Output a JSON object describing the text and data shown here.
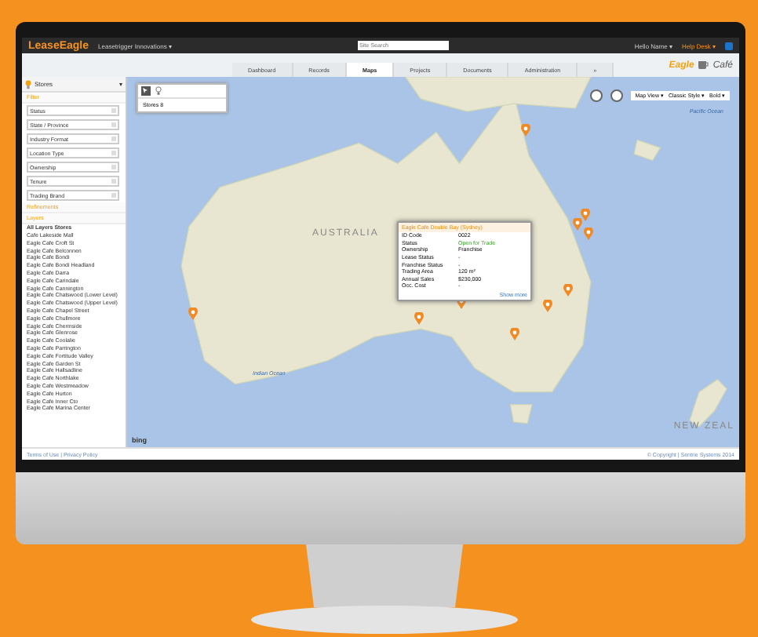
{
  "topbar": {
    "logo": "LeaseEagle",
    "org": "Leasetrigger Innovations ▾",
    "search_placeholder": "Site Search",
    "user": "Hello Name ▾",
    "help": "Help Desk ▾"
  },
  "tabs": [
    {
      "label": "Dashboard",
      "selected": false
    },
    {
      "label": "Records",
      "selected": false
    },
    {
      "label": "Maps",
      "selected": true
    },
    {
      "label": "Projects",
      "selected": false
    },
    {
      "label": "Documents",
      "selected": false
    },
    {
      "label": "Administration",
      "selected": false
    },
    {
      "label": "»",
      "selected": false
    }
  ],
  "brand": {
    "name": "Eagle",
    "sub": "Café"
  },
  "sidebar": {
    "title": "Stores",
    "caret": "▾",
    "filter_heading": "Filter",
    "filters": [
      "Status",
      "State / Province",
      "Industry Format",
      "Location Type",
      "Ownership",
      "Tenure",
      "Trading Brand"
    ],
    "refinements_heading": "Refinements",
    "layers_heading": "Layers",
    "stores": [
      "All Layers Stores",
      "Cafe Lakeside Mall",
      "Eagle Cafe Croft St",
      "Eagle Cafe Belconnen",
      "Eagle Cafe Bondi",
      "Eagle Cafe Bondi Headland",
      "Eagle Cafe Darra",
      "Eagle Cafe Carindale",
      "Eagle Cafe Cannington",
      "Eagle Cafe Chatswood (Lower Level)",
      "Eagle Cafe Chatswood (Upper Level)",
      "Eagle Cafe Chapel Street",
      "Eagle Cafe Chullmore",
      "Eagle Cafe Chermside",
      "Eagle Cafe Glenrose",
      "Eagle Cafe Coolalie",
      "Eagle Cafe Parrington",
      "Eagle Cafe Fortitude Valley",
      "Eagle Cafe Garden St",
      "Eagle Cafe Hallsadline",
      "Eagle Cafe Northlake",
      "Eagle Cafe Westmeadow",
      "Eagle Cafe Hurton",
      "Eagle Cafe Inner Cto",
      "Eagle Cafe Marina Center"
    ]
  },
  "map": {
    "panel_label": "Stores 8",
    "controls": [
      "Map View ▾",
      "Classic Style ▾",
      "Bold ▾"
    ],
    "labels": [
      {
        "kind": "ocean",
        "text": "Pacific Ocean"
      },
      {
        "kind": "ocean",
        "text": "Indian Ocean"
      },
      {
        "kind": "country",
        "text": "AUSTRALIA"
      },
      {
        "kind": "country",
        "text": "NEW ZEAL"
      }
    ],
    "popup": {
      "title": "Eagle Cafe Double Bay (Sydney)",
      "rows": [
        {
          "label": "ID Code",
          "value": "0022",
          "kind": "plain"
        },
        {
          "label": "Status",
          "value": "Open for Trade",
          "kind": "good"
        },
        {
          "label": "Ownership",
          "value": "Franchise",
          "kind": "plain"
        },
        {
          "label": "Lease Status",
          "value": "-",
          "kind": "plain"
        },
        {
          "label": "Franchise Status",
          "value": "-",
          "kind": "plain"
        },
        {
          "label": "Trading Area",
          "value": "120 m²",
          "kind": "plain"
        },
        {
          "label": "Annual Sales",
          "value": "$230,000",
          "kind": "plain"
        },
        {
          "label": "Occ. Cost",
          "value": "-",
          "kind": "plain"
        }
      ],
      "link": "Show more"
    },
    "attribution": "bing"
  },
  "footer": {
    "links": "Terms of Use | Privacy Policy",
    "copyright": "© Copyright | Sentrie Systems 2014"
  }
}
